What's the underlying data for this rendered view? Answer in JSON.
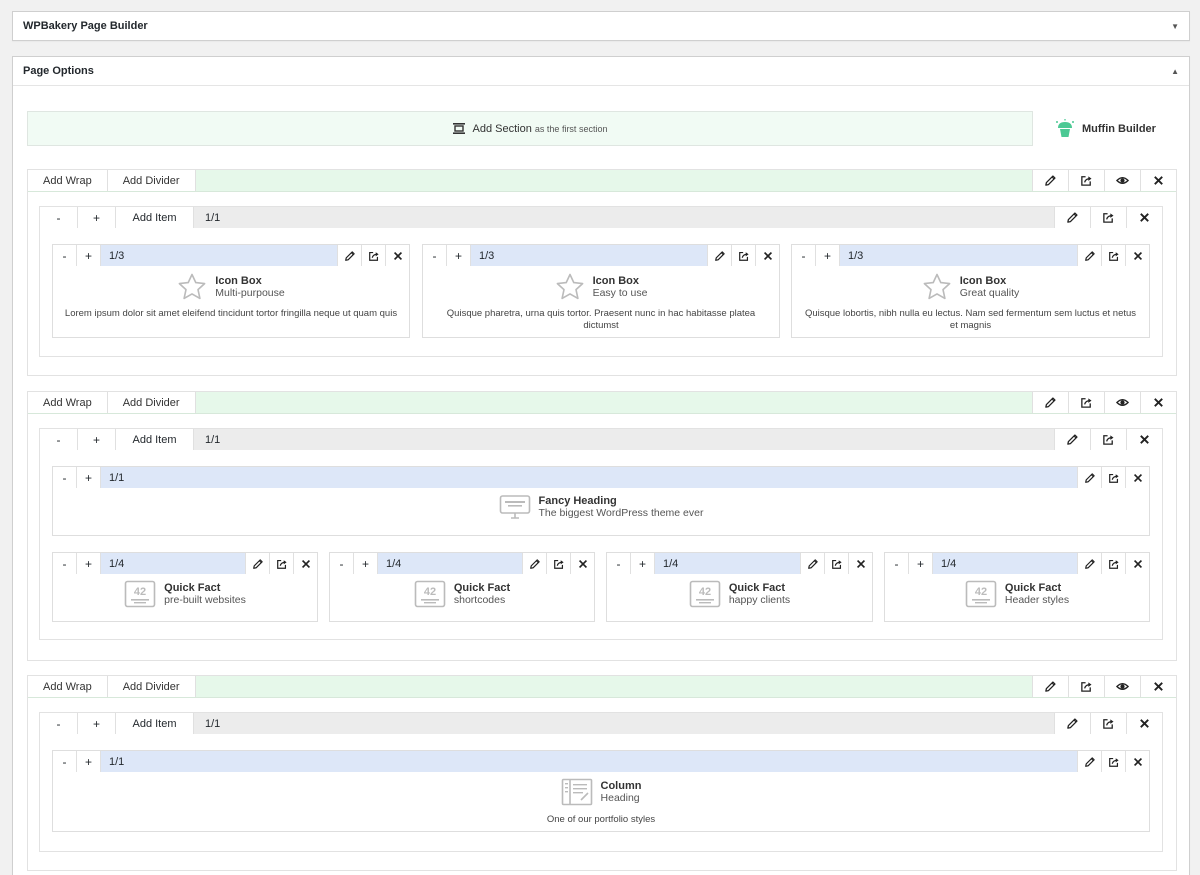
{
  "postboxes": {
    "wpbakery_title": "WPBakery Page Builder",
    "options_title": "Page Options"
  },
  "add_section": {
    "label": "Add Section",
    "sub": "as the first section"
  },
  "logo_text": "Muffin Builder",
  "labels": {
    "add_wrap": "Add Wrap",
    "add_divider": "Add Divider",
    "add_item": "Add Item",
    "minus": "-",
    "plus": "+"
  },
  "icons": {
    "edit": "pencil-icon",
    "clone": "share-icon",
    "hide": "eye-icon",
    "delete": "close-icon",
    "collapse": "caret-icon",
    "section": "section-icon",
    "logo": "muffin-logo-icon",
    "star": "star-icon",
    "heading": "heading-widget-icon",
    "quickfact": "quickfact-widget-icon",
    "column": "column-widget-icon"
  },
  "colors": {
    "section_bar": "#e6f8ea",
    "wrap_bar": "#ececec",
    "item_bar": "#dde7f8",
    "accent": "#4cc994"
  },
  "sections": [
    {
      "wrap_size": "1/1",
      "items": [
        {
          "size": "1/3",
          "icon": "star",
          "title": "Icon Box",
          "subtitle": "Multi-purpouse",
          "desc": "Lorem ipsum dolor sit amet eleifend tincidunt tortor fringilla neque ut quam quis"
        },
        {
          "size": "1/3",
          "icon": "star",
          "title": "Icon Box",
          "subtitle": "Easy to use",
          "desc": "Quisque pharetra, urna quis tortor. Praesent nunc in hac habitasse platea dictumst"
        },
        {
          "size": "1/3",
          "icon": "star",
          "title": "Icon Box",
          "subtitle": "Great quality",
          "desc": "Quisque lobortis, nibh nulla eu lectus. Nam sed fermentum sem luctus et netus et magnis"
        }
      ]
    },
    {
      "wrap_size": "1/1",
      "items": [
        {
          "size": "1/1",
          "icon": "heading",
          "title": "Fancy Heading",
          "subtitle": "The biggest WordPress theme ever",
          "desc": ""
        },
        {
          "size": "1/4",
          "icon": "quickfact",
          "title": "Quick Fact",
          "subtitle": "pre-built websites",
          "desc": ""
        },
        {
          "size": "1/4",
          "icon": "quickfact",
          "title": "Quick Fact",
          "subtitle": "shortcodes",
          "desc": ""
        },
        {
          "size": "1/4",
          "icon": "quickfact",
          "title": "Quick Fact",
          "subtitle": "happy clients",
          "desc": ""
        },
        {
          "size": "1/4",
          "icon": "quickfact",
          "title": "Quick Fact",
          "subtitle": "Header styles",
          "desc": ""
        }
      ]
    },
    {
      "wrap_size": "1/1",
      "items": [
        {
          "size": "1/1",
          "icon": "column",
          "title": "Column",
          "subtitle": "Heading",
          "desc": "One of our portfolio styles"
        }
      ]
    }
  ],
  "quickfact_number": "42"
}
